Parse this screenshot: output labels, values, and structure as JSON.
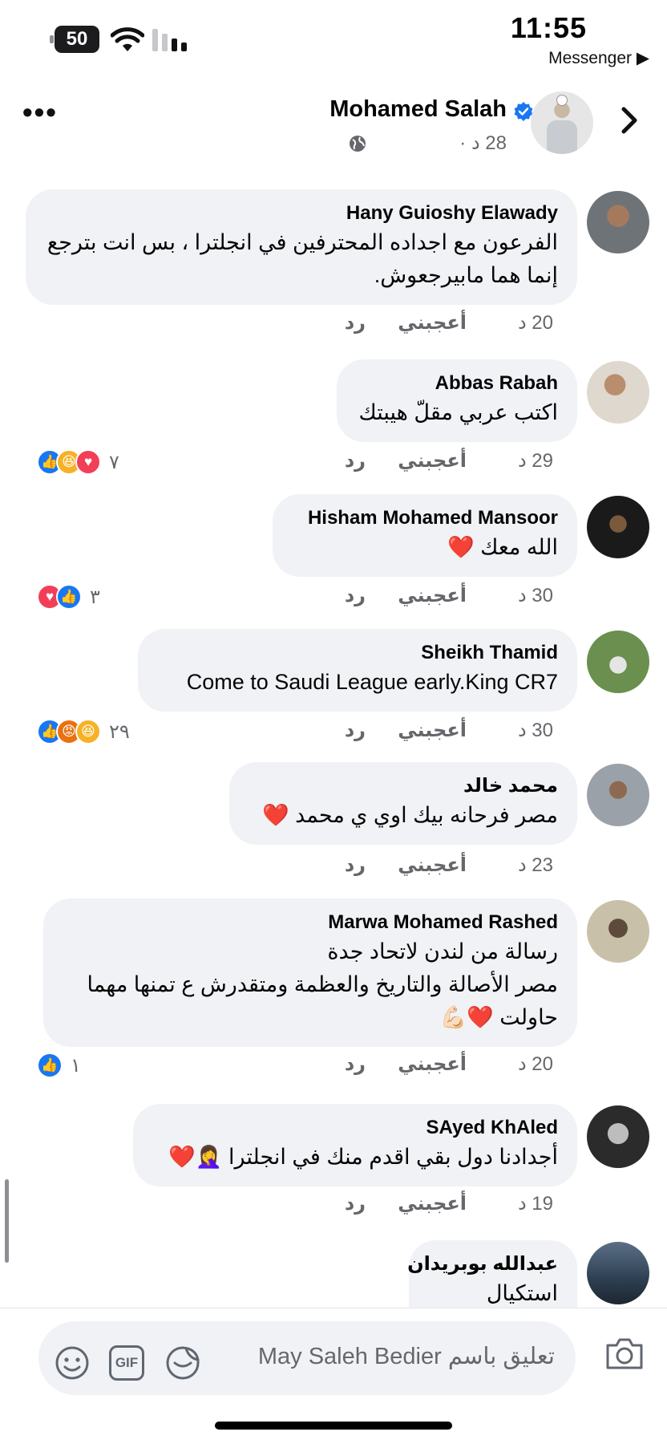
{
  "status_bar": {
    "battery": "50",
    "time": "11:55",
    "back_app": "Messenger ▶"
  },
  "header": {
    "page_name": "Mohamed Salah",
    "meta": "28 د ·"
  },
  "comments": [
    {
      "author": "Hany Guioshy Elawady",
      "text": "الفرعون مع اجداده المحترفين في انجلترا ، بس انت بترجع\nإنما هما مابيرجعوش.",
      "time": "20 د",
      "like": "أعجبني",
      "reply": "رد",
      "reactions": [],
      "reaction_count": ""
    },
    {
      "author": "Abbas Rabah",
      "text": "اكتب عربي مقلّ هيبتك",
      "time": "29 د",
      "like": "أعجبني",
      "reply": "رد",
      "reactions": [
        "like",
        "haha",
        "love"
      ],
      "reaction_count": "٧"
    },
    {
      "author": "Hisham Mohamed Mansoor",
      "text": "الله معك ❤️",
      "time": "30 د",
      "like": "أعجبني",
      "reply": "رد",
      "reactions": [
        "love",
        "like"
      ],
      "reaction_count": "٣"
    },
    {
      "author": "Sheikh Thamid",
      "text": "Come to Saudi League early.King CR7",
      "time": "30 د",
      "like": "أعجبني",
      "reply": "رد",
      "reactions": [
        "like",
        "angry",
        "haha"
      ],
      "reaction_count": "٢٩"
    },
    {
      "author": "محمد خالد",
      "text": "مصر فرحانه بيك اوي ي محمد ❤️",
      "time": "23 د",
      "like": "أعجبني",
      "reply": "رد",
      "reactions": [],
      "reaction_count": ""
    },
    {
      "author": "Marwa Mohamed Rashed",
      "text": "رسالة من لندن لاتحاد جدة\nمصر الأصالة والتاريخ والعظمة ومتقدرش ع تمنها   مهما\nحاولت ❤️💪🏻",
      "time": "20 د",
      "like": "أعجبني",
      "reply": "رد",
      "reactions": [
        "like"
      ],
      "reaction_count": "١"
    },
    {
      "author": "SAyed KhAled",
      "text": "أجدادنا دول بقي اقدم منك في انجلترا 🤦‍♀️❤️",
      "time": "19 د",
      "like": "أعجبني",
      "reply": "رد",
      "reactions": [],
      "reaction_count": ""
    },
    {
      "author": "عبدالله بوبريدان",
      "text": "استكيال رسمي",
      "time": "",
      "like": "",
      "reply": "",
      "reactions": [],
      "reaction_count": ""
    }
  ],
  "composer": {
    "placeholder": "تعليق باسم May Saleh Bedier",
    "gif_label": "GIF"
  },
  "colors": {
    "bubble": "#f0f2f5",
    "like_blue": "#1877f2",
    "love_red": "#f33e58",
    "haha_yellow": "#f7b125",
    "angry_orange": "#e9710f",
    "secondary_text": "#65676b"
  }
}
